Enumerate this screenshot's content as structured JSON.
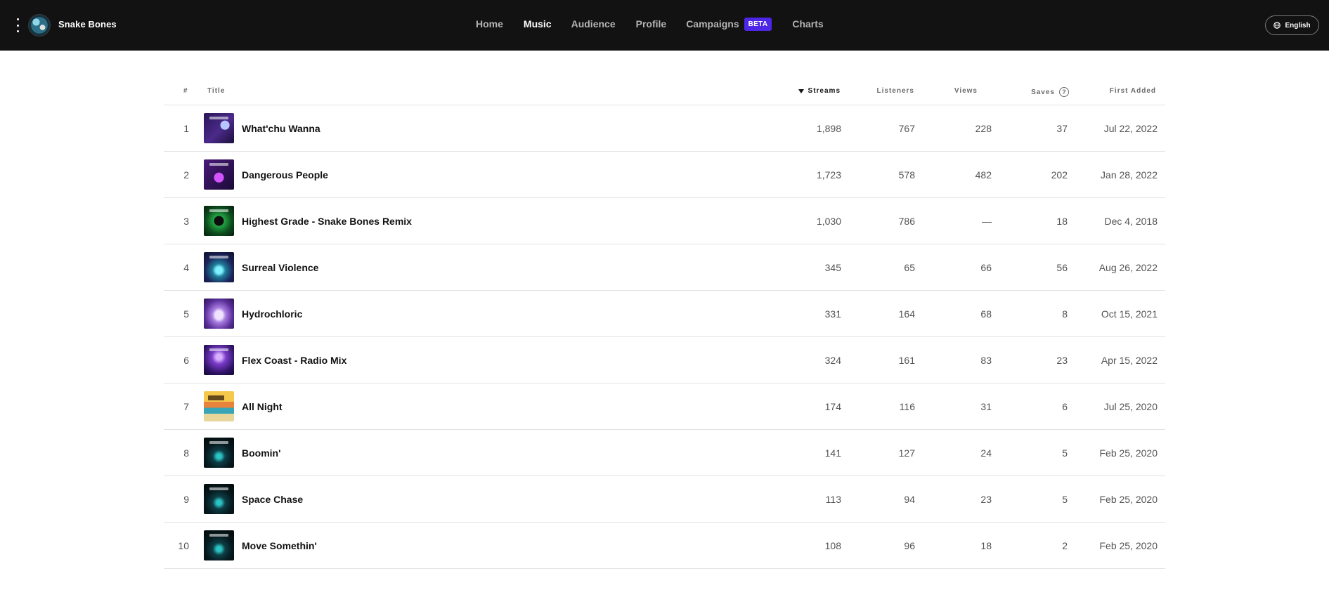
{
  "header": {
    "artist_name": "Snake Bones",
    "nav": {
      "home": "Home",
      "music": "Music",
      "audience": "Audience",
      "profile": "Profile",
      "campaigns": "Campaigns",
      "campaigns_badge": "BETA",
      "charts": "Charts"
    },
    "language": "English"
  },
  "table": {
    "columns": {
      "num": "#",
      "title": "Title",
      "streams": "Streams",
      "listeners": "Listeners",
      "views": "Views",
      "saves": "Saves",
      "saves_help": "?",
      "first_added": "First Added"
    },
    "sorted_by": "Streams",
    "rows": [
      {
        "rank": "1",
        "title": "What'chu Wanna",
        "streams": "1,898",
        "listeners": "767",
        "views": "228",
        "saves": "37",
        "first_added": "Jul 22, 2022"
      },
      {
        "rank": "2",
        "title": "Dangerous People",
        "streams": "1,723",
        "listeners": "578",
        "views": "482",
        "saves": "202",
        "first_added": "Jan 28, 2022"
      },
      {
        "rank": "3",
        "title": "Highest Grade - Snake Bones Remix",
        "streams": "1,030",
        "listeners": "786",
        "views": "—",
        "saves": "18",
        "first_added": "Dec 4, 2018"
      },
      {
        "rank": "4",
        "title": "Surreal Violence",
        "streams": "345",
        "listeners": "65",
        "views": "66",
        "saves": "56",
        "first_added": "Aug 26, 2022"
      },
      {
        "rank": "5",
        "title": "Hydrochloric",
        "streams": "331",
        "listeners": "164",
        "views": "68",
        "saves": "8",
        "first_added": "Oct 15, 2021"
      },
      {
        "rank": "6",
        "title": "Flex Coast - Radio Mix",
        "streams": "324",
        "listeners": "161",
        "views": "83",
        "saves": "23",
        "first_added": "Apr 15, 2022"
      },
      {
        "rank": "7",
        "title": "All Night",
        "streams": "174",
        "listeners": "116",
        "views": "31",
        "saves": "6",
        "first_added": "Jul 25, 2020"
      },
      {
        "rank": "8",
        "title": "Boomin'",
        "streams": "141",
        "listeners": "127",
        "views": "24",
        "saves": "5",
        "first_added": "Feb 25, 2020"
      },
      {
        "rank": "9",
        "title": "Space Chase",
        "streams": "113",
        "listeners": "94",
        "views": "23",
        "saves": "5",
        "first_added": "Feb 25, 2020"
      },
      {
        "rank": "10",
        "title": "Move Somethin'",
        "streams": "108",
        "listeners": "96",
        "views": "18",
        "saves": "2",
        "first_added": "Feb 25, 2020"
      }
    ]
  }
}
